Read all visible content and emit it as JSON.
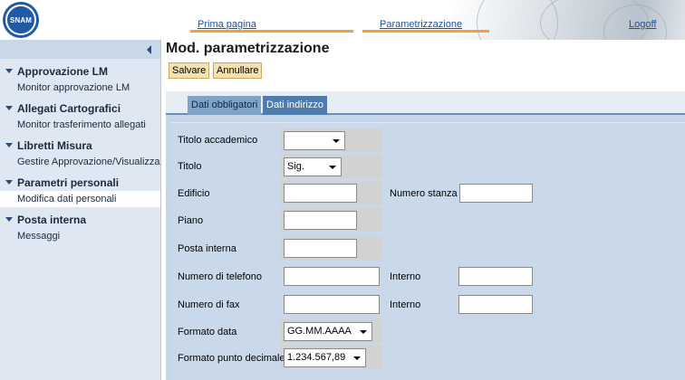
{
  "header": {
    "logo_text": "SNAM",
    "links": {
      "home": "Prima pagina",
      "params": "Parametrizzazione",
      "logoff": "Logoff"
    }
  },
  "sidebar": {
    "groups": [
      {
        "title": "Approvazione LM",
        "items": [
          "Monitor approvazione LM"
        ]
      },
      {
        "title": "Allegati Cartografici",
        "items": [
          "Monitor trasferimento allegati"
        ]
      },
      {
        "title": "Libretti Misura",
        "items": [
          "Gestire Approvazione/Visualizzazione"
        ]
      },
      {
        "title": "Parametri personali",
        "items": [
          "Modifica dati personali"
        ]
      },
      {
        "title": "Posta interna",
        "items": [
          "Messaggi"
        ]
      }
    ]
  },
  "main": {
    "title": "Mod. parametrizzazione",
    "buttons": {
      "save": "Salvare",
      "cancel": "Annullare"
    },
    "tabs": [
      "Dati obbligatori",
      "Dati indirizzo"
    ],
    "form": {
      "titolo_accademico": {
        "label": "Titolo accademico",
        "value": ""
      },
      "titolo": {
        "label": "Titolo",
        "value": "Sig."
      },
      "edificio": {
        "label": "Edificio",
        "value": ""
      },
      "numero_stanza": {
        "label": "Numero stanza",
        "value": ""
      },
      "piano": {
        "label": "Piano",
        "value": ""
      },
      "posta_interna": {
        "label": "Posta interna",
        "value": ""
      },
      "telefono": {
        "label": "Numero di telefono",
        "value": ""
      },
      "telefono_interno": {
        "label": "Interno",
        "value": ""
      },
      "fax": {
        "label": "Numero di fax",
        "value": ""
      },
      "fax_interno": {
        "label": "Interno",
        "value": ""
      },
      "formato_data": {
        "label": "Formato data",
        "value": "GG.MM.AAAA"
      },
      "formato_decimale": {
        "label": "Formato punto decimale",
        "value": "1.234.567,89"
      }
    }
  }
}
